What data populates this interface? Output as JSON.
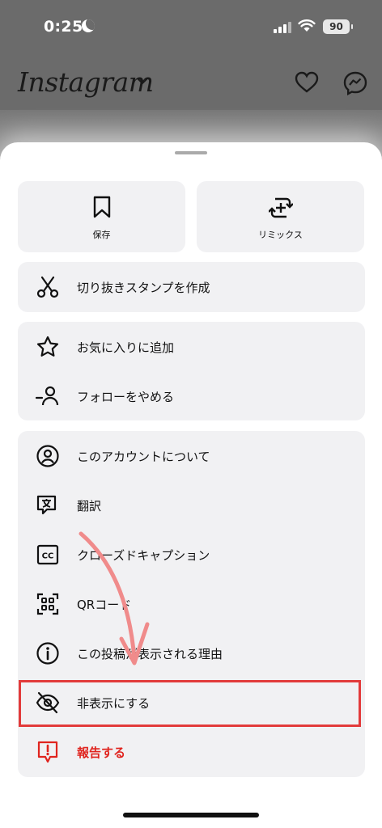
{
  "status_bar": {
    "time": "0:25",
    "battery": "90"
  },
  "header": {
    "logo": "Instagram"
  },
  "sheet": {
    "tiles": [
      {
        "label": "保存",
        "icon": "bookmark-icon"
      },
      {
        "label": "リミックス",
        "icon": "remix-icon"
      }
    ],
    "group1": [
      {
        "label": "切り抜きスタンプを作成",
        "icon": "scissors-icon"
      }
    ],
    "group2": [
      {
        "label": "お気に入りに追加",
        "icon": "star-icon"
      },
      {
        "label": "フォローをやめる",
        "icon": "unfollow-icon"
      }
    ],
    "group3": [
      {
        "label": "このアカウントについて",
        "icon": "account-circle-icon"
      },
      {
        "label": "翻訳",
        "icon": "translate-icon"
      },
      {
        "label": "クローズドキャプション",
        "icon": "closed-caption-icon"
      },
      {
        "label": "QRコード",
        "icon": "qr-code-icon"
      },
      {
        "label": "この投稿が表示される理由",
        "icon": "info-icon"
      },
      {
        "label": "非表示にする",
        "icon": "hide-eye-icon"
      },
      {
        "label": "報告する",
        "icon": "report-icon"
      }
    ]
  },
  "colors": {
    "highlight": "#e23b3b",
    "danger": "#e0241e",
    "annotation_arrow": "#f08b8b"
  }
}
